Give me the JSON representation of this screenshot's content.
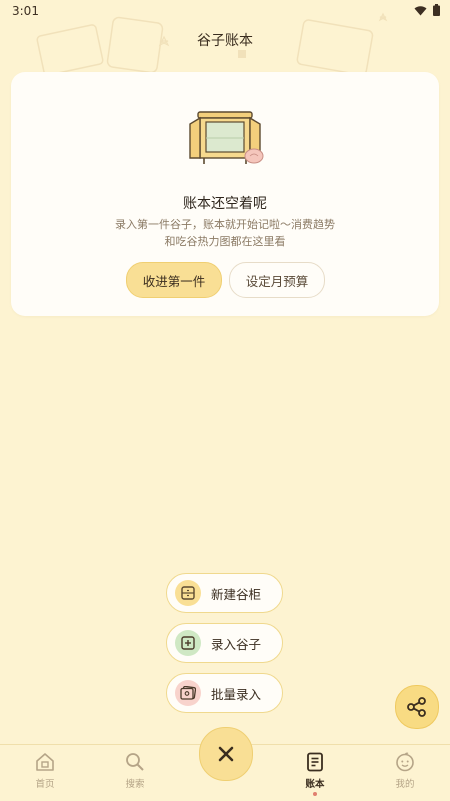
{
  "status_bar": {
    "time": "3:01"
  },
  "header": {
    "title": "谷子账本"
  },
  "empty_state": {
    "title": "账本还空着呢",
    "desc_line1": "录入第一件谷子，账本就开始记啦～消费趋势",
    "desc_line2": "和吃谷热力图都在这里看",
    "primary_button": "收进第一件",
    "secondary_button": "设定月预算"
  },
  "fab_menu": {
    "items": [
      {
        "label": "新建谷柜",
        "icon": "cabinet-icon",
        "color": "#f9df95"
      },
      {
        "label": "录入谷子",
        "icon": "add-square-icon",
        "color": "#cfe8c4"
      },
      {
        "label": "批量录入",
        "icon": "photos-icon",
        "color": "#f8d3cc"
      }
    ]
  },
  "share": {
    "icon": "share-icon"
  },
  "tabbar": {
    "tabs": [
      {
        "label": "首页",
        "icon": "home-icon"
      },
      {
        "label": "搜索",
        "icon": "search-icon"
      },
      {
        "label": "账本",
        "icon": "ledger-icon",
        "active": true
      },
      {
        "label": "我的",
        "icon": "profile-icon"
      }
    ],
    "close_icon": "close-icon"
  },
  "colors": {
    "background": "#fdf3d1",
    "accent": "#f9df95",
    "card": "#fffdf8",
    "active_dot": "#e07f6f"
  }
}
